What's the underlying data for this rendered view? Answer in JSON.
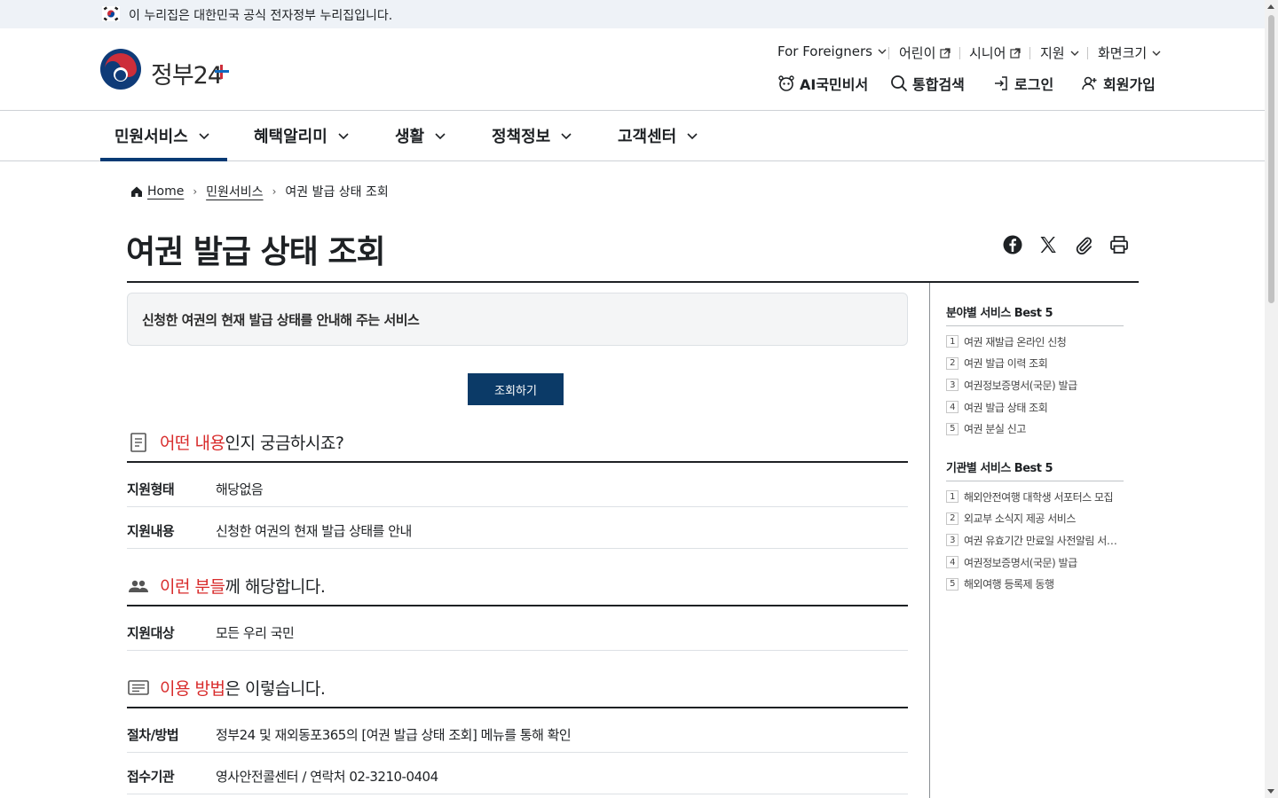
{
  "gov_banner": {
    "text": "이 누리집은 대한민국 공식 전자정부 누리집입니다."
  },
  "logo": {
    "text": "정부24"
  },
  "utility_nav": [
    {
      "label": "For Foreigners",
      "icon": "chevron-down-icon"
    },
    {
      "label": "어린이",
      "icon": "external-link-icon"
    },
    {
      "label": "시니어",
      "icon": "external-link-icon"
    },
    {
      "label": "지원",
      "icon": "chevron-down-icon"
    },
    {
      "label": "화면크기",
      "icon": "chevron-down-icon"
    }
  ],
  "main_actions": [
    {
      "label": "AI국민비서",
      "icon": "ai-assistant-icon"
    },
    {
      "label": "통합검색",
      "icon": "search-icon"
    },
    {
      "label": "로그인",
      "icon": "login-icon"
    },
    {
      "label": "회원가입",
      "icon": "user-add-icon"
    }
  ],
  "gnb": [
    {
      "label": "민원서비스",
      "active": true
    },
    {
      "label": "혜택알리미"
    },
    {
      "label": "생활"
    },
    {
      "label": "정책정보"
    },
    {
      "label": "고객센터"
    }
  ],
  "breadcrumb": {
    "home": "Home",
    "level1": "민원서비스",
    "current": "여권 발급 상태 조회"
  },
  "page": {
    "title": "여권 발급 상태 조회",
    "summary": "신청한 여권의 현재 발급 상태를 안내해 주는 서비스",
    "query_button": "조회하기"
  },
  "share_icons": [
    "facebook-icon",
    "x-icon",
    "link-icon",
    "print-icon"
  ],
  "sections": [
    {
      "highlight": "어떤 내용",
      "rest": "인지 궁금하시죠?",
      "icon": "document-icon",
      "rows": [
        {
          "key": "지원형태",
          "value": "해당없음"
        },
        {
          "key": "지원내용",
          "value": "신청한 여권의 현재 발급 상태를 안내"
        }
      ]
    },
    {
      "highlight": "이런 분들",
      "rest": "께 해당합니다.",
      "icon": "people-icon",
      "rows": [
        {
          "key": "지원대상",
          "value": "모든 우리 국민"
        }
      ]
    },
    {
      "highlight": "이용 방법",
      "rest": "은 이렇습니다.",
      "icon": "list-icon",
      "rows": [
        {
          "key": "절차/방법",
          "value": "정부24 및 재외동포365의 [여권 발급 상태 조회] 메뉴를 통해 확인"
        },
        {
          "key": "접수기관",
          "value": "영사안전콜센터 / 연락처 02-3210-0404"
        }
      ]
    }
  ],
  "sidebar": {
    "field_best": {
      "title": "분야별 서비스 Best 5",
      "items": [
        "여권 재발급 온라인 신청",
        "여권 발급 이력 조회",
        "여권정보증명서(국문) 발급",
        "여권 발급 상태 조회",
        "여권 분실 신고"
      ]
    },
    "agency_best": {
      "title": "기관별 서비스 Best 5",
      "items": [
        "해외안전여행 대학생 서포터스 모집",
        "외교부 소식지 제공 서비스",
        "여권 유효기간 만료일 사전알림 서비스",
        "여권정보증명서(국문) 발급",
        "해외여행 등록제 동행"
      ]
    }
  },
  "colors": {
    "accent_navy": "#0b3a67",
    "highlight_red": "#d82b2b",
    "gnb_active": "#063a74"
  }
}
